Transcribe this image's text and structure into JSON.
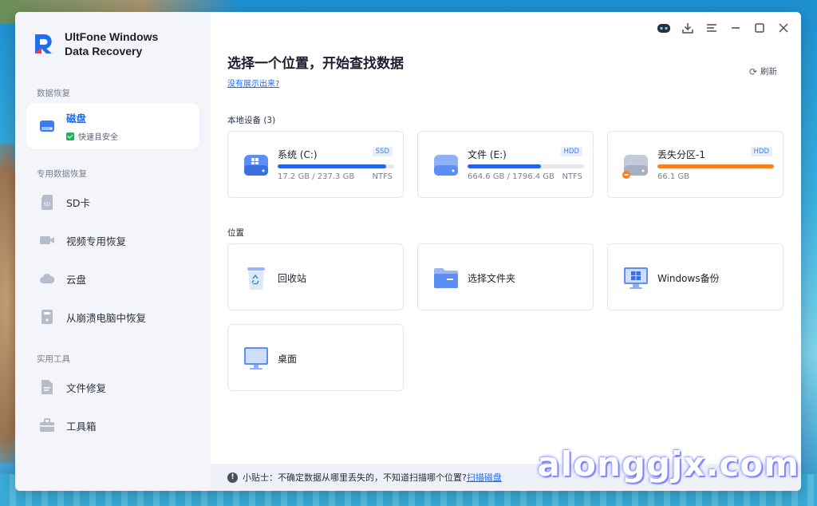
{
  "app": {
    "name_line1": "UltFone Windows",
    "name_line2": "Data Recovery"
  },
  "sidebar": {
    "section_recovery": "数据恢复",
    "active_item": {
      "label": "磁盘",
      "sub": "快速且安全"
    },
    "section_special": "专用数据恢复",
    "special_items": [
      "SD卡",
      "视频专用恢复",
      "云盘",
      "从崩溃电脑中恢复"
    ],
    "section_tools": "实用工具",
    "tool_items": [
      "文件修复",
      "工具箱"
    ]
  },
  "main": {
    "title": "选择一个位置，开始查找数据",
    "help_link": "没有展示出来?",
    "refresh": "刷新",
    "local_devices_label": "本地设备 (3)",
    "locations_label": "位置"
  },
  "drives": [
    {
      "name": "系统 (C:)",
      "type": "SSD",
      "size": "17.2 GB / 237.3 GB",
      "fs": "NTFS",
      "used_fraction": 0.93,
      "color": "#2563eb"
    },
    {
      "name": "文件 (E:)",
      "type": "HDD",
      "size": "664.6 GB / 1796.4 GB",
      "fs": "NTFS",
      "used_fraction": 0.63,
      "color": "#2563eb"
    },
    {
      "name": "丢失分区-1",
      "type": "HDD",
      "size": "66.1 GB",
      "fs": "",
      "used_fraction": 1.0,
      "color": "#f5821f"
    }
  ],
  "locations": [
    "回收站",
    "选择文件夹",
    "Windows备份",
    "桌面"
  ],
  "tip": {
    "prefix": "小贴士：不确定数据从哪里丢失的，不知道扫描哪个位置?",
    "link": "扫描磁盘"
  },
  "watermark": "alonggjx.com",
  "colors": {
    "accent": "#1f6cf0",
    "sidebar_bg": "#f3f5fa",
    "lost_partition": "#f5821f"
  }
}
